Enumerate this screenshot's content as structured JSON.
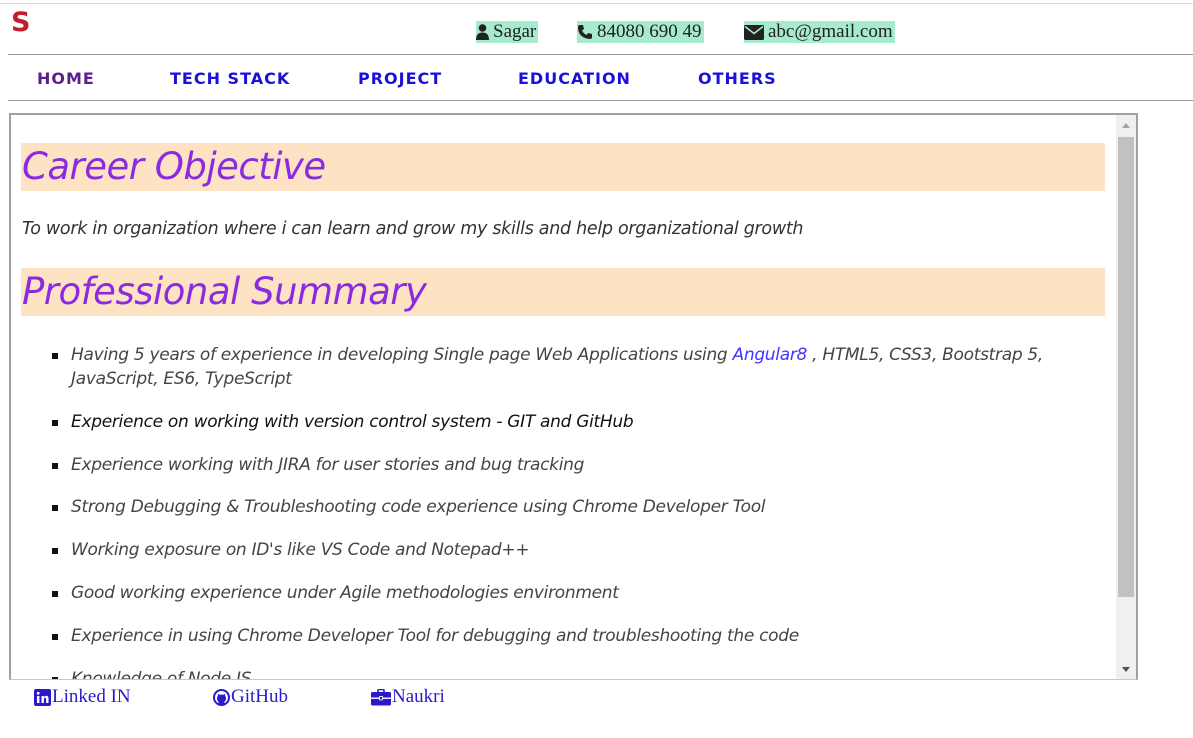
{
  "header": {
    "logo": "S",
    "name": "Sagar",
    "phone": "84080 690 49",
    "email": "abc@gmail.com",
    "icons": {
      "name": "user-icon",
      "phone": "phone-icon",
      "email": "envelope-icon"
    },
    "contact_bg": "#a6ebcd",
    "logo_color": "#c0202e"
  },
  "nav": {
    "items": [
      {
        "label": "HOME"
      },
      {
        "label": "TECH STACK"
      },
      {
        "label": "PROJECT"
      },
      {
        "label": "EDUCATION"
      },
      {
        "label": "OTHERS"
      }
    ],
    "active": "HOME"
  },
  "main": {
    "career_heading": "Career Objective",
    "objective": "To work in organization where i can learn and grow my skills and help organizational growth",
    "summary_heading": "Professional Summary",
    "summary": [
      {
        "before": "Having 5 years of experience in developing Single page Web Applications using ",
        "link": "Angular8",
        "after": " , HTML5, CSS3, Bootstrap 5, JavaScript, ES6, TypeScript"
      },
      {
        "text": "Experience on working with version control system - GIT and GitHub"
      },
      {
        "text": "Experience working with JIRA for user stories and bug tracking"
      },
      {
        "text": "Strong Debugging & Troubleshooting code experience using Chrome Developer Tool"
      },
      {
        "text": "Working exposure on ID's like VS Code and Notepad++"
      },
      {
        "text": "Good working experience under Agile methodologies environment"
      },
      {
        "text": "Experience in using Chrome Developer Tool for debugging and troubleshooting the code"
      },
      {
        "text": "Knowledge of Node JS"
      }
    ],
    "heading_bg": "#fde3c4",
    "heading_color": "#8a2be2"
  },
  "footer": {
    "links": [
      {
        "label": "Linked IN",
        "icon": "linkedin-icon"
      },
      {
        "label": "GitHub",
        "icon": "github-icon"
      },
      {
        "label": "Naukri",
        "icon": "briefcase-icon"
      }
    ]
  }
}
